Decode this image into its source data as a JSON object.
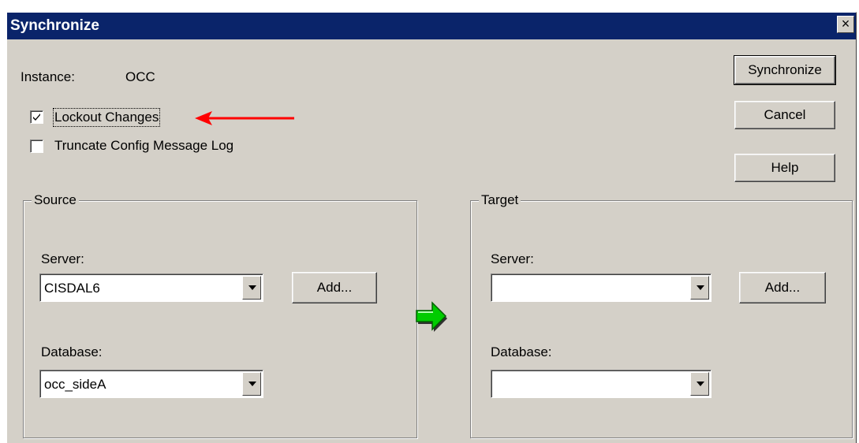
{
  "window": {
    "title": "Synchronize",
    "close_glyph": "×"
  },
  "instance": {
    "label": "Instance:",
    "value": "OCC"
  },
  "options": {
    "lockout": {
      "label": "Lockout Changes",
      "checked": true
    },
    "truncate": {
      "label": "Truncate Config Message Log",
      "checked": false
    }
  },
  "buttons": {
    "synchronize": "Synchronize",
    "cancel": "Cancel",
    "help": "Help"
  },
  "source": {
    "title": "Source",
    "server_label": "Server:",
    "server_value": "CISDAL6",
    "add_label": "Add...",
    "database_label": "Database:",
    "database_value": "occ_sideA"
  },
  "target": {
    "title": "Target",
    "server_label": "Server:",
    "server_value": "",
    "add_label": "Add...",
    "database_label": "Database:",
    "database_value": ""
  },
  "colors": {
    "title_bar": "#0a246a",
    "dialog_bg": "#d4d0c8",
    "arrow_annotation": "#ff0000",
    "sync_arrow": "#00cc00"
  }
}
